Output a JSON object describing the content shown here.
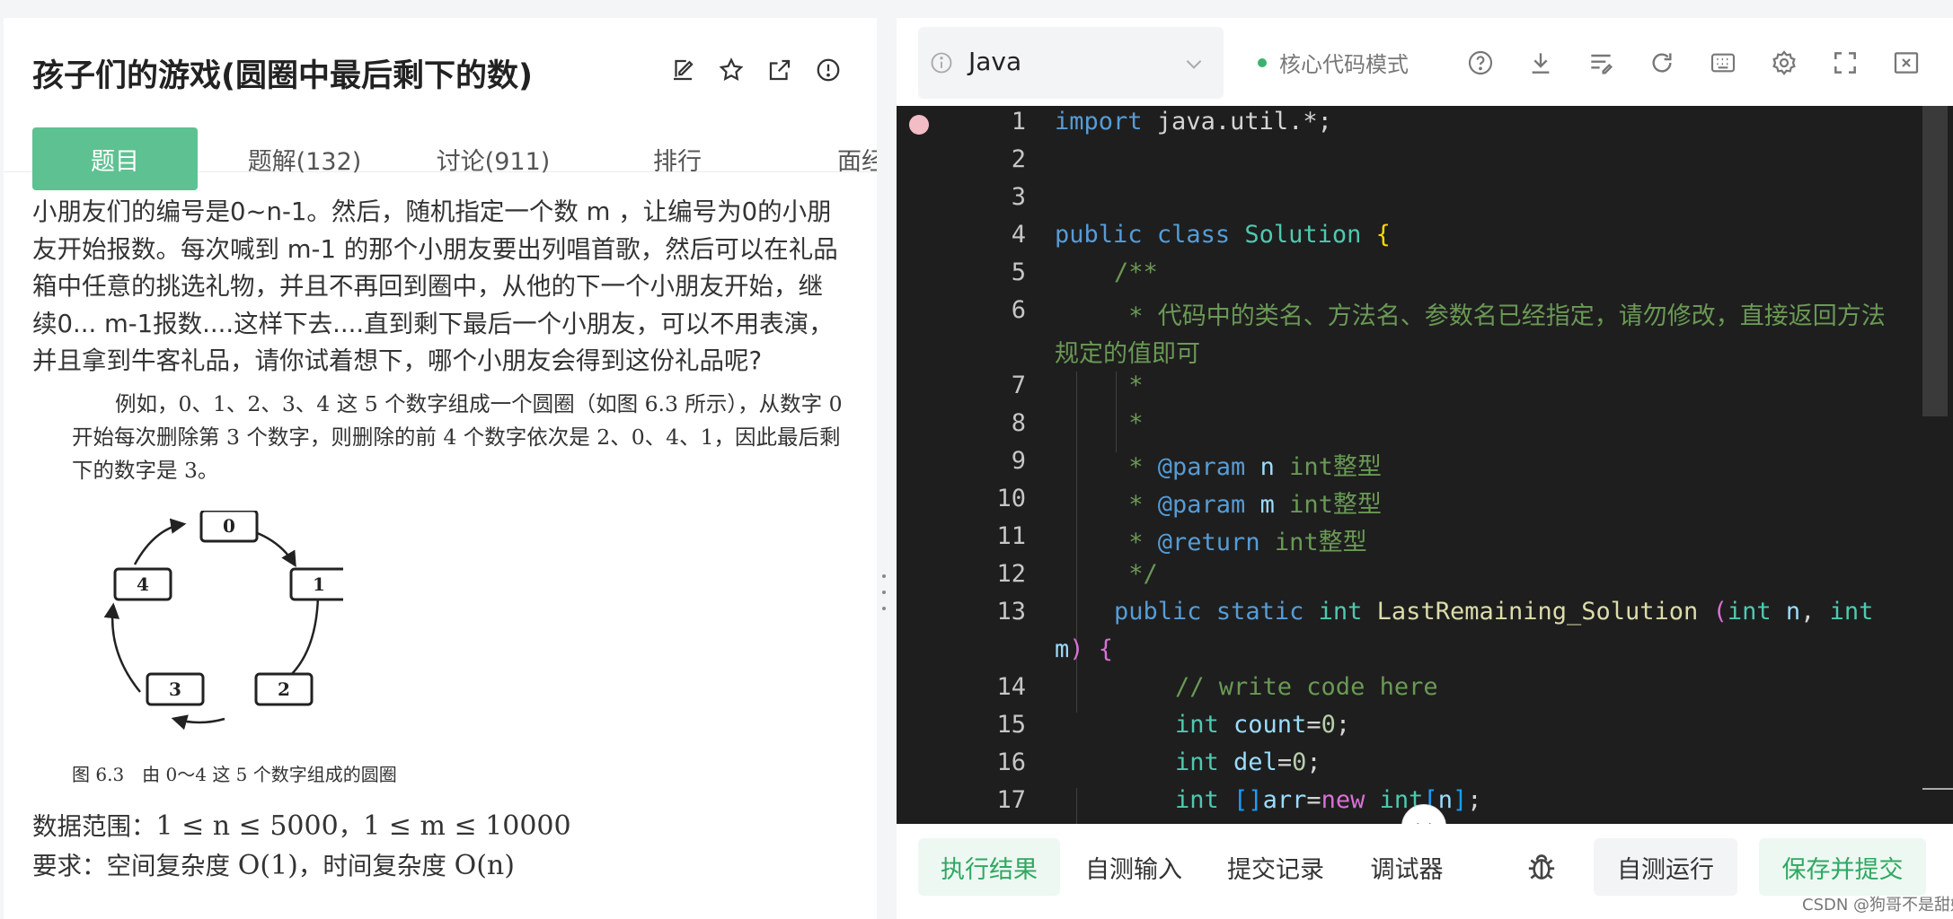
{
  "problem": {
    "title": "孩子们的游戏(圆圈中最后剩下的数)",
    "tabs": [
      "题目",
      "题解(132)",
      "讨论(911)",
      "排行",
      "面经"
    ],
    "description": "小朋友们的编号是0~n-1。然后，随机指定一个数 m ，让编号为0的小朋友开始报数。每次喊到 m-1 的那个小朋友要出列唱首歌，然后可以在礼品箱中任意的挑选礼物，并且不再回到圈中，从他的下一个小朋友开始，继续0... m-1报数....这样下去....直到剩下最后一个小朋友，可以不用表演，并且拿到牛客礼品，请你试着想下，哪个小朋友会得到这份礼品呢?",
    "book_paragraph": "例如，0、1、2、3、4 这 5 个数字组成一个圆圈（如图 6.3 所示），从数字 0 开始每次删除第 3 个数字，则删除的前 4 个数字依次是 2、0、4、1，因此最后剩下的数字是 3。",
    "circle_nodes": [
      "0",
      "1",
      "2",
      "3",
      "4"
    ],
    "figure_caption": "图 6.3　由 0～4 这 5 个数字组成的圆圈",
    "range_label": "数据范围：",
    "range_math_1": "1 ≤ n ≤ 5000",
    "range_sep": "，",
    "range_math_2": "1 ≤ m ≤ 10000",
    "req_label": "要求：空间复杂度 ",
    "req_math_1": "O(1)",
    "req_mid": "，时间复杂度 ",
    "req_math_2": "O(n)"
  },
  "editor": {
    "language": "Java",
    "mode": "核心代码模式",
    "line_numbers": [
      "1",
      "2",
      "3",
      "4",
      "5",
      "6",
      "7",
      "8",
      "9",
      "10",
      "11",
      "12",
      "13",
      "14",
      "15",
      "16",
      "17"
    ],
    "code": {
      "l1_kw": "import",
      "l1_rest": " java.util.*;",
      "l4_kw1": "public",
      "l4_kw2": "class",
      "l4_ty": "Solution",
      "l4_br": "{",
      "l5": "/**",
      "l6a": " * 代码中的类名、方法名、参数名已经指定，请勿修改，直接返回方法",
      "l6b": "规定的值即可",
      "l7": " *",
      "l8": " *",
      "l9_star": " * ",
      "l9_an": "@param",
      "l9_p": " n",
      "l9_rest": " int整型",
      "l10_star": " * ",
      "l10_an": "@param",
      "l10_p": " m",
      "l10_rest": " int整型",
      "l11_star": " * ",
      "l11_an": "@return",
      "l11_rest": " int整型",
      "l12": " */",
      "l13_kw1": "public",
      "l13_kw2": "static",
      "l13_kw3": "int",
      "l13_fn": "LastRemaining_Solution",
      "l13_br": "(",
      "l13_kw4": "int",
      "l13_p1": " n",
      "l13_comma": ",",
      "l13_kw5": "int",
      "l13b_p": "m",
      "l13b_br": ")",
      "l13b_br2": "{",
      "l14": "// write code here",
      "l15_kw": "int",
      "l15_v": " count",
      "l15_eq": "=",
      "l15_n": "0",
      "l15_end": ";",
      "l16_kw": "int",
      "l16_v": " del",
      "l16_eq": "=",
      "l16_n": "0",
      "l16_end": ";",
      "l17_kw": "int",
      "l17_br": " []",
      "l17_v": "arr",
      "l17_eq": "=",
      "l17_new": "new",
      "l17_kw2": " int",
      "l17_br2": "[",
      "l17_n": "n",
      "l17_br3": "]",
      "l17_end": ";"
    }
  },
  "bottom": {
    "tabs": [
      "执行结果",
      "自测输入",
      "提交记录",
      "调试器"
    ],
    "run": "自测运行",
    "submit": "保存并提交"
  },
  "watermark": "CSDN @狗哥不是甜妹",
  "colors": {
    "accent_green": "#5ec192",
    "editor_bg": "#1e1e1e"
  }
}
